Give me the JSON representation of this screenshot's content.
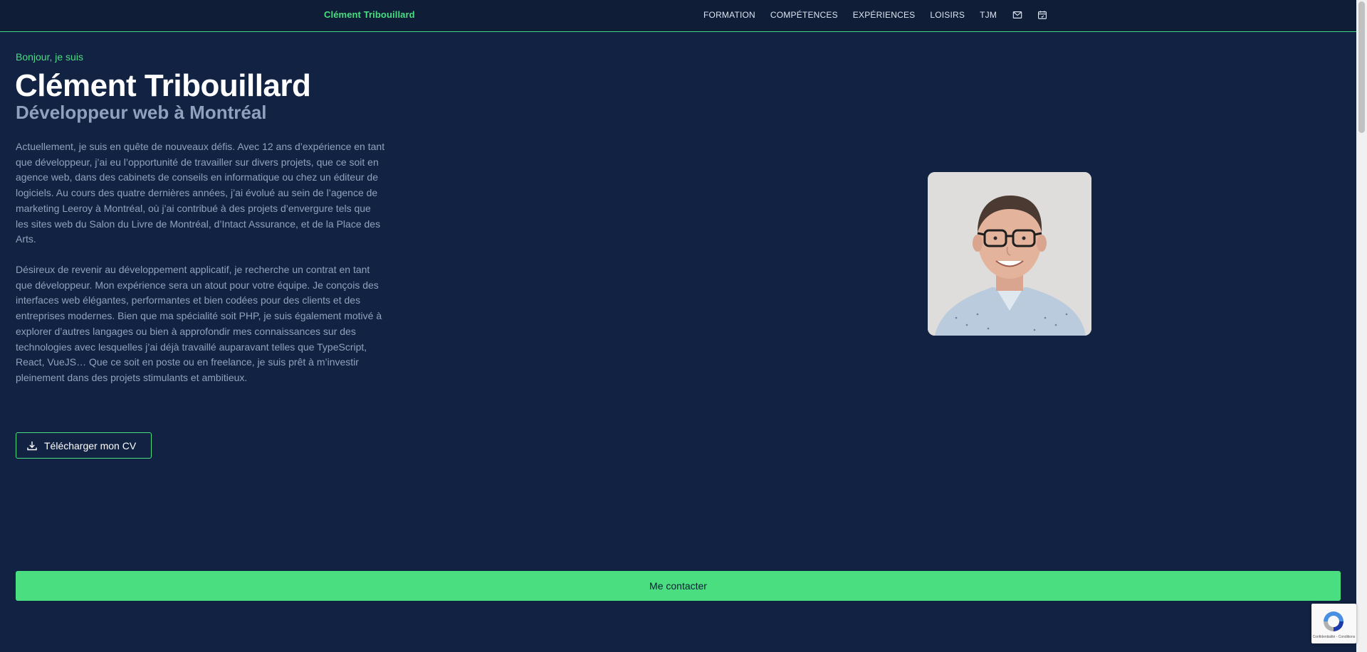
{
  "header": {
    "brand": "Clément Tribouillard",
    "nav": [
      "FORMATION",
      "COMPÉTENCES",
      "EXPÉRIENCES",
      "LOISIRS",
      "TJM"
    ],
    "icons": [
      "mail-icon",
      "calendar-icon"
    ]
  },
  "hero": {
    "greeting": "Bonjour, je suis",
    "name": "Clément Tribouillard",
    "role": "Développeur web à Montréal",
    "bio1": "Actuellement, je suis en quête de nouveaux défis. Avec 12 ans d’expérience en tant que développeur, j’ai eu l’opportunité de travailler sur divers projets, que ce soit en agence web, dans des cabinets de conseils en informatique ou chez un éditeur de logiciels. Au cours des quatre dernières années, j’ai évolué au sein de l’agence de marketing Leeroy à Montréal, où j’ai contribué à des projets d’envergure tels que les sites web du Salon du Livre de Montréal, d’Intact Assurance, et de la Place des Arts.",
    "bio2": "Désireux de revenir au développement applicatif, je recherche un contrat en tant que développeur. Mon expérience sera un atout pour votre équipe. Je conçois des interfaces web élégantes, performantes et bien codées pour des clients et des entreprises modernes. Bien que ma spécialité soit PHP, je suis également motivé à explorer d’autres langages ou bien à approfondir mes connaissances sur des technologies avec lesquelles j’ai déjà travaillé auparavant telles que TypeScript, React, VueJS… Que ce soit en poste ou en freelance, je suis prêt à m’investir pleinement dans des projets stimulants et ambitieux.",
    "cv_button": "Télécharger mon CV"
  },
  "contact_button": "Me contacter",
  "recaptcha": {
    "text": "Confidentialité - Conditions"
  },
  "colors": {
    "background": "#122242",
    "accent": "#4ade80",
    "header": "#0f1d37"
  }
}
